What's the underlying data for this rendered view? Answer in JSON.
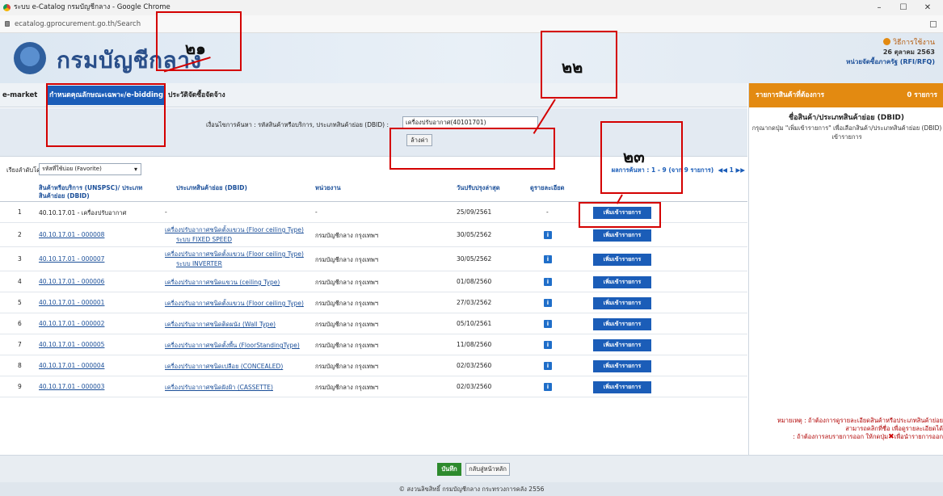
{
  "window": {
    "title": "ระบบ e-Catalog กรมบัญชีกลาง - Google Chrome",
    "url": "ecatalog.gprocurement.go.th/Search",
    "minimize": "–",
    "maximize": "☐",
    "close": "✕"
  },
  "header": {
    "logo_text": "กรมบัญชีกลาง",
    "help_link": "วิธีการใช้งาน",
    "date": "26 ตุลาคม 2563",
    "unit": "หน่วยจัดซื้อภาครัฐ (RFI/RFQ)"
  },
  "nav": {
    "items": [
      "e-market",
      "กำหนดคุณลักษณะเฉพาะ/e-bidding",
      "ประวัติจัดซื้อจัดจ้าง"
    ]
  },
  "search": {
    "label": "เงื่อนไขการค้นหา : รหัสสินค้าหรือบริการ, ประเภทสินค้าย่อย (DBID) :",
    "value": "เครื่องปรับอากาศ(40101701)",
    "clear_label": "ล้างค่า"
  },
  "sort": {
    "label": "เรียงลำดับโดย :",
    "selected": "รหัสที่ใช้บ่อย (Favorite)",
    "paging": "ผลการค้นหา : 1 - 9 (จาก 9 รายการ)",
    "nav": "◀◀ 1 ▶▶"
  },
  "table": {
    "headers": [
      "สินค้าหรือบริการ (UNSPSC)/ ประเภทสินค้าย่อย (DBID)",
      "ประเภทสินค้าย่อย (DBID)",
      "หน่วยงาน",
      "วันปรับปรุงล่าสุด",
      "ดูรายละเอียด"
    ],
    "add_label": "เพิ่มเข้ารายการ",
    "info_icon": "i",
    "rows": [
      {
        "no": "1",
        "code": "40.10.17.01 - เครื่องปรับอากาศ",
        "dbid": "-",
        "dbid2": "",
        "agency": "-",
        "date": "25/09/2561",
        "detail": "-"
      },
      {
        "no": "2",
        "code": "40.10.17.01 - 000008",
        "dbid": "เครื่องปรับอากาศชนิดตั้งแขวน (Floor ceiling Type)",
        "dbid2": "ระบบ FIXED SPEED",
        "agency": "กรมบัญชีกลาง กรุงเทพฯ",
        "date": "30/05/2562",
        "detail": ""
      },
      {
        "no": "3",
        "code": "40.10.17.01 - 000007",
        "dbid": "เครื่องปรับอากาศชนิดตั้งแขวน (Floor ceiling Type)",
        "dbid2": "ระบบ INVERTER",
        "agency": "กรมบัญชีกลาง กรุงเทพฯ",
        "date": "30/05/2562",
        "detail": ""
      },
      {
        "no": "4",
        "code": "40.10.17.01 - 000006",
        "dbid": "เครื่องปรับอากาศชนิดแขวน (ceiling Type)",
        "dbid2": "",
        "agency": "กรมบัญชีกลาง กรุงเทพฯ",
        "date": "01/08/2560",
        "detail": ""
      },
      {
        "no": "5",
        "code": "40.10.17.01 - 000001",
        "dbid": "เครื่องปรับอากาศชนิดตั้งแขวน (Floor ceiling Type)",
        "dbid2": "",
        "agency": "กรมบัญชีกลาง กรุงเทพฯ",
        "date": "27/03/2562",
        "detail": ""
      },
      {
        "no": "6",
        "code": "40.10.17.01 - 000002",
        "dbid": "เครื่องปรับอากาศชนิดติดผนัง (Wall Type)",
        "dbid2": "",
        "agency": "กรมบัญชีกลาง กรุงเทพฯ",
        "date": "05/10/2561",
        "detail": ""
      },
      {
        "no": "7",
        "code": "40.10.17.01 - 000005",
        "dbid": "เครื่องปรับอากาศชนิดตั้งพื้น (FloorStandingType)",
        "dbid2": "",
        "agency": "กรมบัญชีกลาง กรุงเทพฯ",
        "date": "11/08/2560",
        "detail": ""
      },
      {
        "no": "8",
        "code": "40.10.17.01 - 000004",
        "dbid": "เครื่องปรับอากาศชนิดเปลือย (CONCEALED)",
        "dbid2": "",
        "agency": "กรมบัญชีกลาง กรุงเทพฯ",
        "date": "02/03/2560",
        "detail": ""
      },
      {
        "no": "9",
        "code": "40.10.17.01 - 000003",
        "dbid": "เครื่องปรับอากาศชนิดฝังฝ้า (CASSETTE)",
        "dbid2": "",
        "agency": "กรมบัญชีกลาง กรุงเทพฯ",
        "date": "02/03/2560",
        "detail": ""
      }
    ]
  },
  "right_panel": {
    "title": "รายการสินค้าที่ต้องการ",
    "count": "0 รายการ",
    "subtitle": "ชื่อสินค้า/ประเภทสินค้าย่อย (DBID)",
    "hint": "กรุณากดปุ่ม \"เพิ่มเข้ารายการ\" เพื่อเลือกสินค้า/ประเภทสินค้าย่อย (DBID) เข้ารายการ",
    "note1": "หมายเหตุ : ถ้าต้องการดูรายละเอียดสินค้าหรือประเภทสินค้าย่อย",
    "note2": "สามารถคลิกที่ชื่อ เพื่อดูรายละเอียดได้",
    "note3a": ": ถ้าต้องการลบรายการออก ให้กดปุ่ม",
    "note3b": "เพื่อนำรายการออก"
  },
  "footer": {
    "save_label": "บันทึก",
    "back_label": "กลับสู่หน้าหลัก",
    "copyright": "© สงวนลิขสิทธิ์ กรมบัญชีกลาง กระทรวงการคลัง 2556"
  },
  "annotations": [
    "๒๑",
    "๒๒",
    "๒๓"
  ],
  "colors": {
    "accent": "#1b5db8",
    "panel_header": "#e38a11",
    "annotation": "#d40000"
  }
}
